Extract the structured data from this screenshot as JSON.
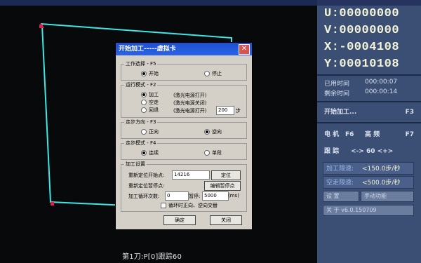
{
  "dialog": {
    "title": "开始加工-----虚拟卡",
    "close": "✕",
    "work_select": {
      "title": "工作选择 - F5",
      "opt1": "开始",
      "opt2": "停止"
    },
    "run_mode": {
      "title": "运行模式 - F2",
      "options": [
        "加工",
        "空走",
        "回退"
      ],
      "notes": [
        "(激光电源打开)",
        "(激光电源关闭)",
        "(激光电源打开)"
      ],
      "steps_value": "200",
      "steps_unit": "步"
    },
    "step_dir": {
      "title": "走步方向 - F3",
      "opt1": "正向",
      "opt2": "逆向"
    },
    "step_mode": {
      "title": "走步模式 - F4",
      "opt1": "连续",
      "opt2": "单段"
    },
    "process_settings": {
      "title": "加工设置",
      "reposition_start_label": "重新定位开始点:",
      "reposition_start_value": "14216",
      "locate_btn": "定位",
      "reposition_pause_label": "重新定位暂停点:",
      "edit_pause_btn": "编辑暂停点",
      "loop_label": "加工循环次数:",
      "loop_value": "0",
      "pause_label": "暂停:",
      "pause_value": "5000",
      "pause_unit": "(ms)",
      "checkbox_label": "循环时正向、逆向交替"
    },
    "ok_btn": "确定",
    "cancel_btn": "关闭"
  },
  "panel": {
    "coords": [
      "U:00000000",
      "V:00000000",
      "X:-0004108",
      "Y:00010108"
    ],
    "used_time_label": "已用时间",
    "used_time_value": "000:00:07",
    "remain_time_label": "剩余时间",
    "remain_time_value": "000:00:14",
    "start_process": "开始加工...",
    "start_key": "F3",
    "electro_label": "电  机",
    "electro_key": "F6",
    "high_freq_label": "高 频",
    "high_freq_key": "F7",
    "track_label": "跟  踪",
    "track_value": "<->  60  <+>",
    "proc_speed_label": "加工限速:",
    "proc_speed_value": "<150.0步/秒",
    "idle_speed_label": "空走限速:",
    "idle_speed_value": "<500.0步/秒",
    "settings_btn": "设  置",
    "manual_btn": "手动功能",
    "about_btn": "关  于 v6.0.150709"
  },
  "status": {
    "knife": "第1刀:P[0]跟踪60"
  }
}
